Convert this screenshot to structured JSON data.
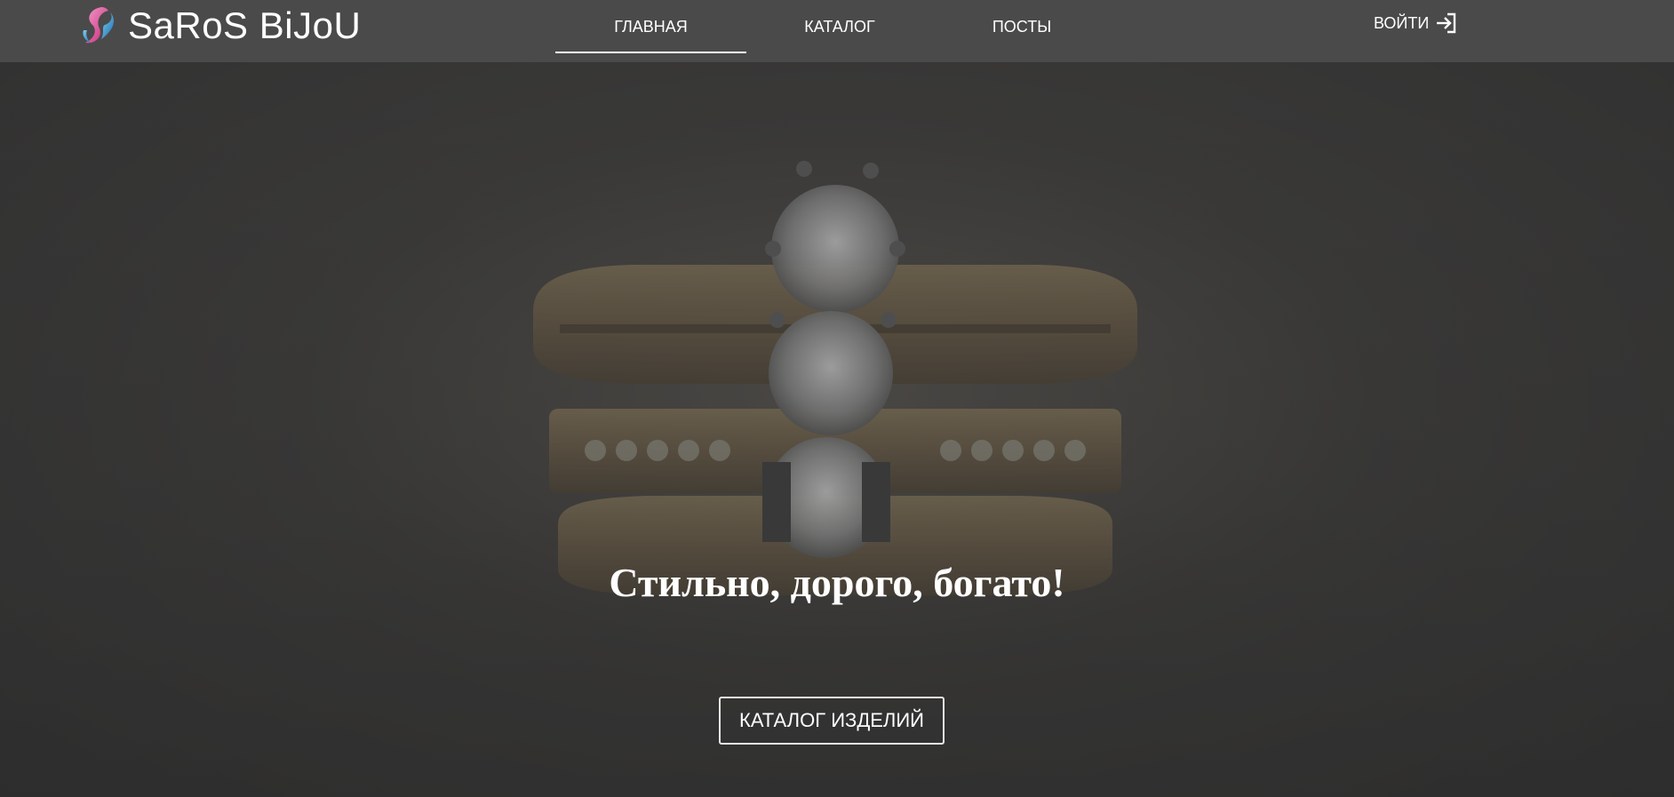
{
  "header": {
    "brand": "SaRoS BiJoU",
    "logo_icon": "swirl-s-logo-icon",
    "nav": {
      "home": "ГЛАВНАЯ",
      "catalog": "КАТАЛОГ",
      "posts": "ПОСТЫ"
    },
    "active_nav": "home",
    "login_label": "ВОЙТИ",
    "login_icon": "sign-in-icon"
  },
  "hero": {
    "title": "Стильно, дорого, богато!",
    "button_label": "КАТАЛОГ ИЗДЕЛИЙ",
    "background_image": "stacked-gold-diamond-rings"
  },
  "colors": {
    "header_bg": "#4a4a4a",
    "text": "#ffffff",
    "hero_overlay": "#3a3a3a",
    "logo_pink": "#d9468f",
    "logo_blue": "#2e9fd6"
  }
}
